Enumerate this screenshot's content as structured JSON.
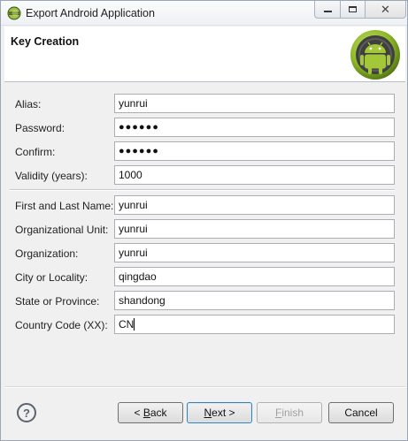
{
  "window": {
    "title": "Export Android Application"
  },
  "header": {
    "page_title": "Key Creation"
  },
  "form": {
    "alias": {
      "label": "Alias:",
      "value": "yunrui"
    },
    "password": {
      "label": "Password:",
      "value": "●●●●●●"
    },
    "confirm": {
      "label": "Confirm:",
      "value": "●●●●●●"
    },
    "validity": {
      "label": "Validity (years):",
      "value": "1000"
    },
    "name": {
      "label": "First and Last Name:",
      "value": "yunrui"
    },
    "org_unit": {
      "label": "Organizational Unit:",
      "value": "yunrui"
    },
    "organization": {
      "label": "Organization:",
      "value": "yunrui"
    },
    "city": {
      "label": "City or Locality:",
      "value": "qingdao"
    },
    "state": {
      "label": "State or Province:",
      "value": "shandong"
    },
    "country": {
      "label": "Country Code (XX):",
      "value": "CN"
    }
  },
  "buttons": {
    "back": {
      "underline": "B",
      "rest": "ack",
      "prefix": "< "
    },
    "next": {
      "underline": "N",
      "rest": "ext >"
    },
    "finish": {
      "underline": "F",
      "rest": "inish"
    },
    "cancel": "Cancel"
  },
  "icons": {
    "app": "eclipse-icon",
    "logo": "android-logo-icon",
    "help": "help-icon"
  },
  "colors": {
    "android_green": "#a4c639",
    "header_bg": "#ffffff",
    "dialog_bg": "#f0f0f0"
  }
}
